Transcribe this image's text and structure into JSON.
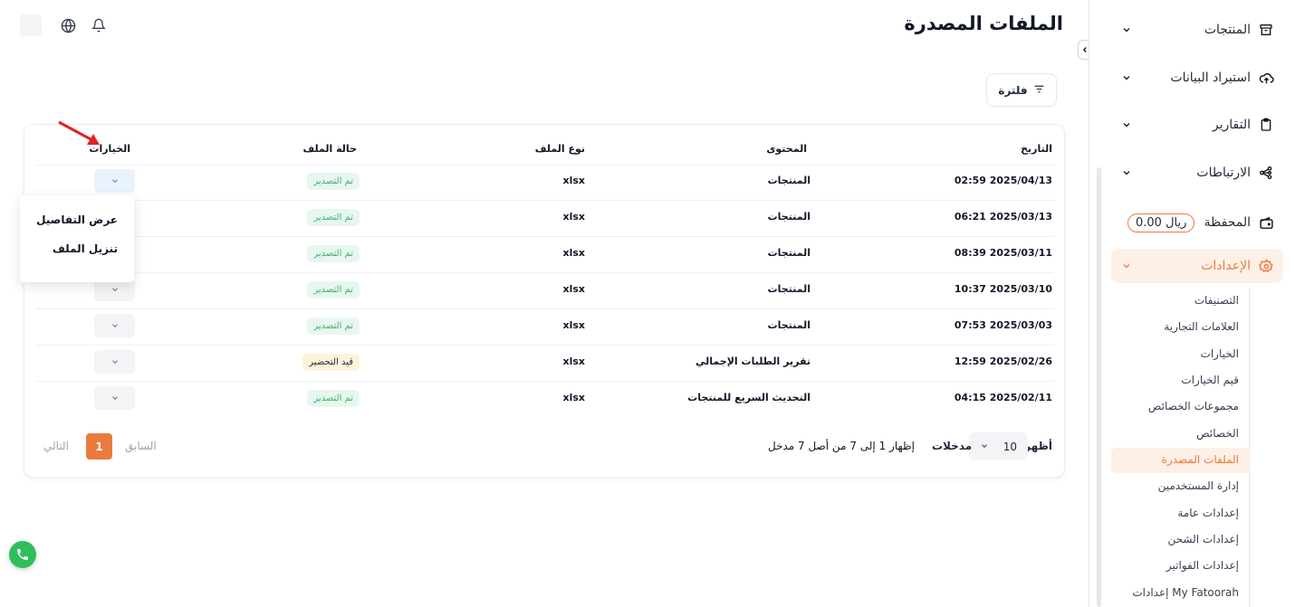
{
  "header": {
    "title": "الملفات المصدرة",
    "icons": [
      "bell-icon",
      "globe-icon",
      "avatar"
    ]
  },
  "toolbar": {
    "filter_label": "فلترة"
  },
  "sidebar": {
    "items": [
      {
        "label": "المنتجات",
        "icon": "archive-box-icon"
      },
      {
        "label": "استيراد البيانات",
        "icon": "cloud-upload-icon"
      },
      {
        "label": "التقارير",
        "icon": "clipboard-icon"
      },
      {
        "label": "الارتباطات",
        "icon": "share-nodes-icon"
      },
      {
        "label": "المحفظة",
        "icon": "wallet-icon",
        "badge": "0.00 ريال"
      },
      {
        "label": "الإعدادات",
        "icon": "gear-icon",
        "active": true
      }
    ],
    "settings_sub": [
      "التصنيفات",
      "العلامات التجارية",
      "الخيارات",
      "قيم الخيارات",
      "مجموعات الخصائص",
      "الخصائص",
      "الملفات المصدرة",
      "إدارة المستخدمين",
      "إعدادات عامة",
      "إعدادات الشحن",
      "إعدادات الفواتير",
      "إعدادات My Fatoorah"
    ],
    "settings_sub_active": "الملفات المصدرة"
  },
  "table": {
    "columns": [
      "التاريخ",
      "المحتوى",
      "نوع الملف",
      "حالة الملف",
      "الخيارات"
    ],
    "rows": [
      {
        "date": "02:59 2025/04/13",
        "content": "المنتجات",
        "type": "xlsx",
        "status": "تم التصدير"
      },
      {
        "date": "06:21 2025/03/13",
        "content": "المنتجات",
        "type": "xlsx",
        "status": "تم التصدير"
      },
      {
        "date": "08:39 2025/03/11",
        "content": "المنتجات",
        "type": "xlsx",
        "status": "تم التصدير"
      },
      {
        "date": "10:37 2025/03/10",
        "content": "المنتجات",
        "type": "xlsx",
        "status": "تم التصدير"
      },
      {
        "date": "07:53 2025/03/03",
        "content": "المنتجات",
        "type": "xlsx",
        "status": "تم التصدير"
      },
      {
        "date": "12:59 2025/02/26",
        "content": "تقرير الطلبات الإجمالي",
        "type": "xlsx",
        "status": "قيد التحضير"
      },
      {
        "date": "04:15 2025/02/11",
        "content": "التحديث السريع للمنتجات",
        "type": "xlsx",
        "status": "تم التصدير"
      }
    ],
    "dropdown": [
      "عرض التفاصيل",
      "تنزيل الملف"
    ]
  },
  "pagination": {
    "show_label": "أظهر",
    "per_page": "10",
    "entries_label": "مدخلات",
    "range_text": "إظهار 1 إلى 7 من أصل 7 مدخل",
    "prev": "السابق",
    "current": "1",
    "next": "التالي"
  },
  "colors": {
    "accent": "#ea7b3d",
    "success": "#3fb26c",
    "success_bg": "#e8f7ee",
    "warning_bg": "#fdf3d9"
  }
}
